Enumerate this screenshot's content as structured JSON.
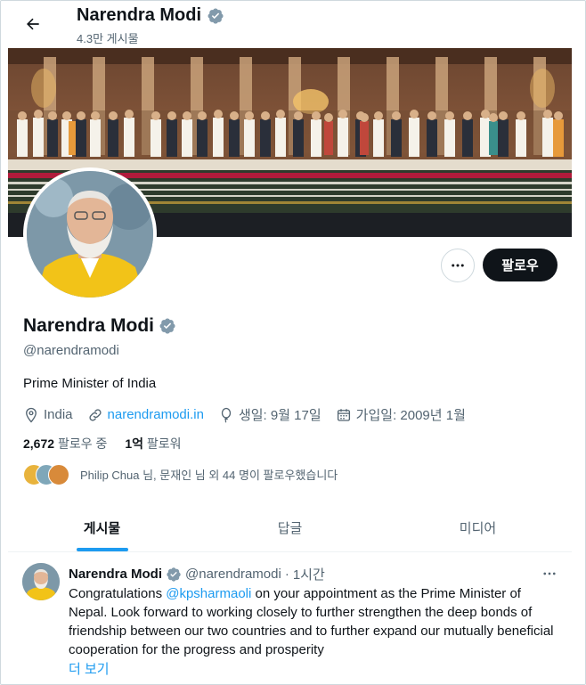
{
  "header": {
    "name": "Narendra Modi",
    "post_count": "4.3만 게시물",
    "icons": {
      "back": "arrow-left-icon",
      "verified": "verified-badge-icon"
    }
  },
  "profile": {
    "name": "Narendra Modi",
    "handle": "@narendramodi",
    "bio": "Prime Minister of India",
    "location": "India",
    "website": "narendramodi.in",
    "birthday": "생일: 9월 17일",
    "joined": "가입일: 2009년 1월",
    "following_count": "2,672",
    "following_label": "팔로우 중",
    "followers_count": "1억",
    "followers_label": "팔로워",
    "followed_by": "Philip Chua 님, 문재인 님 외 44 명이 팔로우했습니다",
    "follow_label": "팔로우"
  },
  "tabs": [
    {
      "label": "게시물",
      "active": true
    },
    {
      "label": "답글",
      "active": false
    },
    {
      "label": "미디어",
      "active": false
    }
  ],
  "tweet": {
    "name": "Narendra Modi",
    "handle": "@narendramodi",
    "separator": "·",
    "time": "1시간",
    "text_before": "Congratulations ",
    "mention": "@kpsharmaoli",
    "text_after": " on your appointment as the Prime Minister of Nepal. Look forward to working closely to further strengthen the deep bonds of friendship between our two countries and to further expand our mutually beneficial cooperation for the progress and prosperity",
    "show_more": "더 보기"
  },
  "colors": {
    "accent": "#1d9bf0",
    "text": "#0f1419",
    "secondary": "#536471",
    "follow_button": "#0f1419"
  }
}
